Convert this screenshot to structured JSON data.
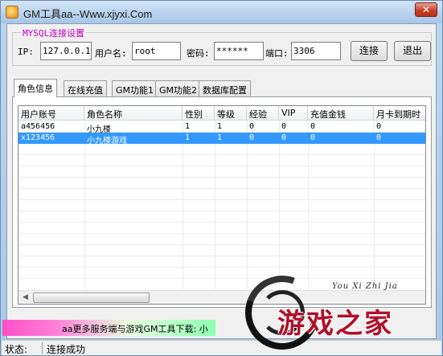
{
  "window": {
    "title": "GM工具aa--Www.xjyxi.Com",
    "close_label": "✕"
  },
  "mysql": {
    "legend": "MYSQL连接设置",
    "ip_label": "IP:",
    "ip_value": "127.0.0.1",
    "user_label": "用户名:",
    "user_value": "root",
    "password_label": "密码:",
    "password_value": "******",
    "port_label": "端口:",
    "port_value": "3306",
    "connect_label": "连接",
    "exit_label": "退出"
  },
  "tabs": [
    {
      "label": "角色信息",
      "active": true
    },
    {
      "label": "在线充值"
    },
    {
      "label": "GM功能1"
    },
    {
      "label": "GM功能2"
    },
    {
      "label": "数据库配置"
    }
  ],
  "grid": {
    "columns": [
      "用户账号",
      "角色名称",
      "性别",
      "等级",
      "经验",
      "VIP",
      "充值金钱",
      "月卡到期时"
    ],
    "rows": [
      [
        "a456456",
        "小九楼",
        "1",
        "1",
        "0",
        "0",
        "0",
        "0"
      ],
      [
        "x123456",
        "小九楼游戏",
        "1",
        "1",
        "0",
        "0",
        "0",
        "0"
      ]
    ],
    "selected_row": 1
  },
  "scrollbar": {
    "left_arrow": "◀"
  },
  "marquee": {
    "text": "aa更多服务端与游戏GM工具下载: 小"
  },
  "status": {
    "label": "状态:",
    "value": "连接成功"
  },
  "watermark": {
    "script": "You Xi Zhi Jia",
    "text": "游戏之家"
  },
  "colors": {
    "selection": "#3399ff",
    "legend": "#c000c0",
    "watermark": "#b0102a"
  }
}
